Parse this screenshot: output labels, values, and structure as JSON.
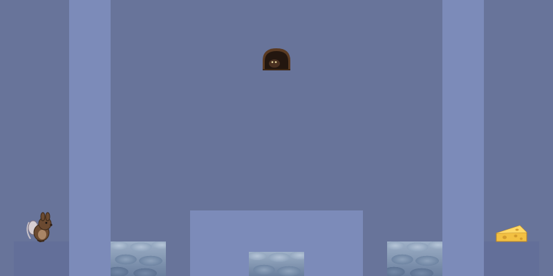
{
  "scene": {
    "background_color": "#68749a",
    "pillar_color": "#7c8bb9",
    "ledge_color": "#636f99",
    "hazard": "cloud-pit"
  },
  "player": {
    "icon": "mouse-icon"
  },
  "goal": {
    "icon": "cheese-icon"
  },
  "exit": {
    "icon": "mouse-hole-icon"
  }
}
